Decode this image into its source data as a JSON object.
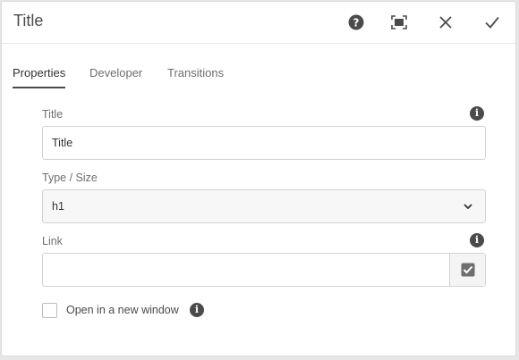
{
  "dialog": {
    "title": "Title",
    "help_icon": "help-circle-icon",
    "fullscreen_icon": "fullscreen-icon",
    "close_icon": "close-icon",
    "done_icon": "checkmark-icon"
  },
  "tabs": [
    {
      "label": "Properties",
      "active": true
    },
    {
      "label": "Developer",
      "active": false
    },
    {
      "label": "Transitions",
      "active": false
    }
  ],
  "form": {
    "title": {
      "label": "Title",
      "value": "Title",
      "icon": "info-icon"
    },
    "type_size": {
      "label": "Type / Size",
      "value": "h1",
      "icon": "chevron-down-icon"
    },
    "link": {
      "label": "Link",
      "value": "",
      "icon": "info-icon",
      "picker_icon": "select-checkbox-icon"
    },
    "new_window": {
      "label": "Open in a new window",
      "checked": false,
      "icon": "info-icon"
    }
  },
  "colors": {
    "text": "#4b4b4b",
    "icon": "#4b4b4b",
    "border": "#d3d3d3"
  }
}
